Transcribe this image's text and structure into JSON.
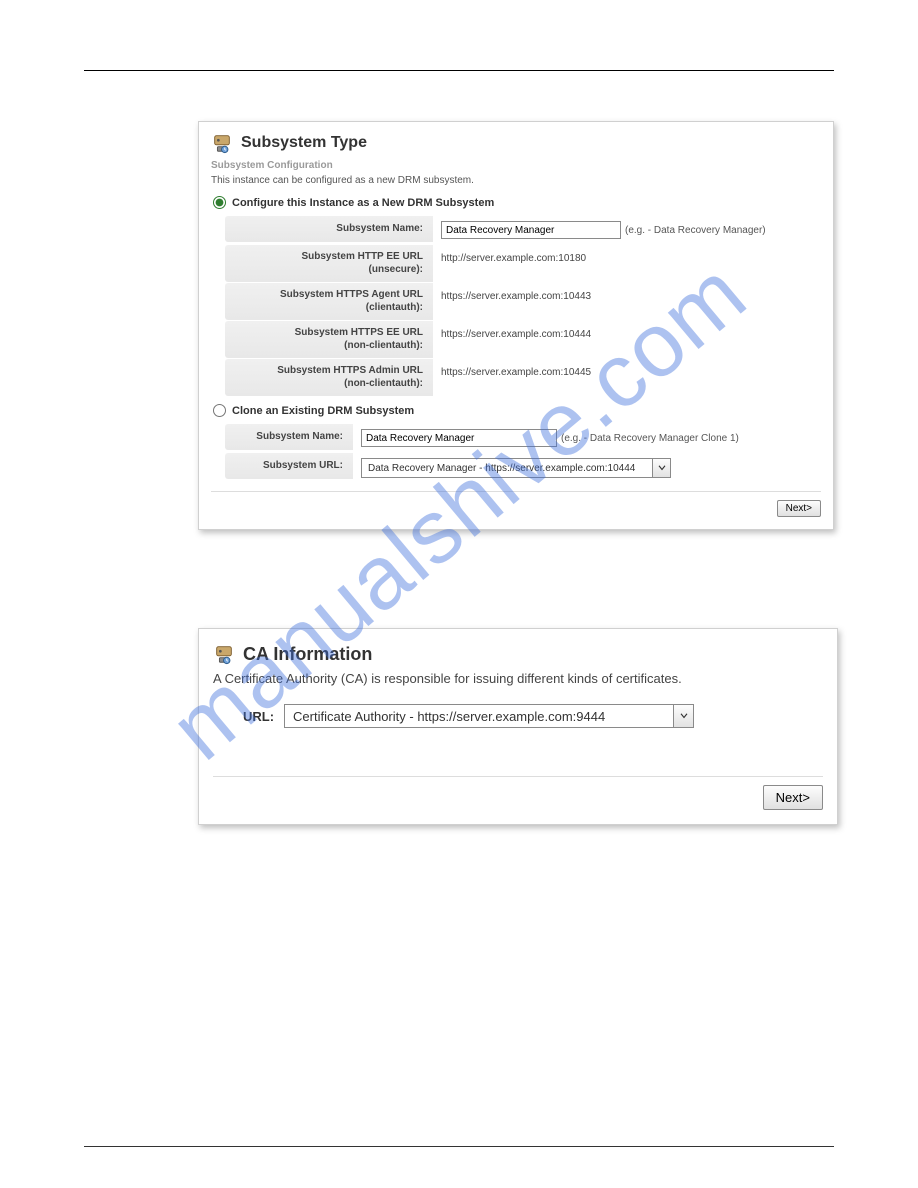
{
  "watermark": "manualshive.com",
  "panel1": {
    "title": "Subsystem Type",
    "subhead": "Subsystem Configuration",
    "intro": "This instance can be configured as a new DRM subsystem.",
    "option_new": {
      "label": "Configure this Instance as a New DRM Subsystem",
      "fields": {
        "name_label": "Subsystem Name:",
        "name_value": "Data Recovery Manager",
        "name_hint": "(e.g. - Data Recovery Manager)",
        "http_ee_label_l1": "Subsystem HTTP EE URL",
        "http_ee_label_l2": "(unsecure):",
        "http_ee_value": "http://server.example.com:10180",
        "https_agent_label_l1": "Subsystem HTTPS Agent URL",
        "https_agent_label_l2": "(clientauth):",
        "https_agent_value": "https://server.example.com:10443",
        "https_ee_label_l1": "Subsystem HTTPS EE URL",
        "https_ee_label_l2": "(non-clientauth):",
        "https_ee_value": "https://server.example.com:10444",
        "https_admin_label_l1": "Subsystem HTTPS Admin URL",
        "https_admin_label_l2": "(non-clientauth):",
        "https_admin_value": "https://server.example.com:10445"
      }
    },
    "option_clone": {
      "label": "Clone an Existing DRM Subsystem",
      "fields": {
        "name_label": "Subsystem Name:",
        "name_value": "Data Recovery Manager",
        "name_hint": "(e.g. - Data Recovery Manager Clone 1)",
        "url_label": "Subsystem URL:",
        "url_value": "Data Recovery Manager - https://server.example.com:10444"
      }
    },
    "next_button": "Next>"
  },
  "panel2": {
    "title": "CA Information",
    "intro": "A Certificate Authority (CA) is responsible for issuing different kinds of certificates.",
    "url_label": "URL:",
    "url_value": "Certificate Authority - https://server.example.com:9444",
    "next_button": "Next>"
  }
}
